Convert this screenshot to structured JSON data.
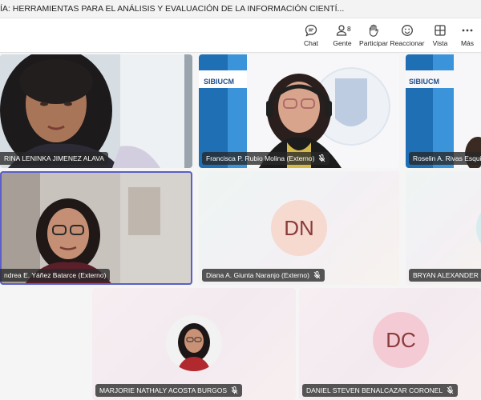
{
  "window": {
    "title": "ÍA: HERRAMIENTAS PARA EL ANÁLISIS Y EVALUACIÓN DE LA INFORMACIÓN CIENTÍ..."
  },
  "toolbar": {
    "chat": "Chat",
    "people": "Gente",
    "people_count": "8",
    "raise": "Participar",
    "react": "Reaccionar",
    "view": "Vista",
    "more": "Más"
  },
  "banner": {
    "brand": "SIBIUCM"
  },
  "participants": [
    {
      "name": "RINA LENINKA JIMENEZ ALAVA"
    },
    {
      "name": "Francisca P. Rubio Molina (Externo)"
    },
    {
      "name": "Roselin A. Rivas Esquivia"
    },
    {
      "name": "ndrea E. Yáñez Batarce (Externo)"
    },
    {
      "name": "Diana A. Giunta Naranjo (Externo)",
      "initials": "DN"
    },
    {
      "name": "BRYAN ALEXANDER MA"
    },
    {
      "name": "MARJORIE NATHALY ACOSTA BURGOS"
    },
    {
      "name": "DANIEL STEVEN BENALCAZAR CORONEL",
      "initials": "DC"
    }
  ],
  "colors": {
    "accent": "#5b5fc7",
    "avatar_dn_bg": "#f6d9cf",
    "avatar_dc_bg": "#f4cbd4",
    "avatar_text": "#8a3b3b"
  }
}
